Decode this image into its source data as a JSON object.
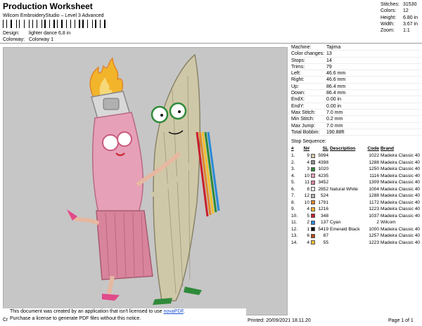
{
  "header": {
    "title": "Production Worksheet",
    "subtitle": "Wilcom EmbroideryStudio – Level 3 Advanced"
  },
  "meta": {
    "design_label": "Design:",
    "design_value": "lighter dance 6,8 in",
    "colorway_label": "Colorway:",
    "colorway_value": "Colorway 1"
  },
  "stats": [
    {
      "k": "Stitches:",
      "v": "31530"
    },
    {
      "k": "Colors:",
      "v": "12"
    },
    {
      "k": "Height:",
      "v": "6.80 in"
    },
    {
      "k": "Width:",
      "v": "3.67 in"
    },
    {
      "k": "Zoom:",
      "v": "1:1"
    }
  ],
  "machine": [
    {
      "k": "Machine:",
      "v": "Tajima"
    },
    {
      "k": "Color changes:",
      "v": "13"
    },
    {
      "k": "Stops:",
      "v": "14"
    },
    {
      "k": "Trims:",
      "v": "79"
    },
    {
      "k": "Left:",
      "v": "46.6 mm"
    },
    {
      "k": "Right:",
      "v": "46.6 mm"
    },
    {
      "k": "Up:",
      "v": "86.4 mm"
    },
    {
      "k": "Down:",
      "v": "86.4 mm"
    },
    {
      "k": "EndX:",
      "v": "0.00 in"
    },
    {
      "k": "EndY:",
      "v": "0.00 in"
    },
    {
      "k": "Max Stitch:",
      "v": "7.0 mm"
    },
    {
      "k": "Min Stitch:",
      "v": "0.2 mm"
    },
    {
      "k": "Max Jump:",
      "v": "7.0 mm"
    },
    {
      "k": "Total Bobbin:",
      "v": "190.88ft"
    }
  ],
  "stop_sequence": {
    "label": "Stop Sequence:",
    "headers": [
      "#",
      "N#",
      "SL",
      "Description",
      "Code",
      "Brand"
    ],
    "rows": [
      {
        "num": "1.",
        "n": "9",
        "color": "#cfc8a8",
        "sl": "5994",
        "desc": "",
        "code": "1022",
        "brand": "Madeira Classic 40"
      },
      {
        "num": "2.",
        "n": "4",
        "color": "#8a8a8a",
        "sl": "4398",
        "desc": "",
        "code": "1288",
        "brand": "Madeira Classic 40"
      },
      {
        "num": "3.",
        "n": "3",
        "color": "#2f8a3a",
        "sl": "1020",
        "desc": "",
        "code": "1250",
        "brand": "Madeira Classic 40"
      },
      {
        "num": "4.",
        "n": "10",
        "color": "#e6a0b8",
        "sl": "4235",
        "desc": "",
        "code": "1116",
        "brand": "Madeira Classic 40"
      },
      {
        "num": "5.",
        "n": "11",
        "color": "#d8849c",
        "sl": "3452",
        "desc": "",
        "code": "1309",
        "brand": "Madeira Classic 40"
      },
      {
        "num": "6.",
        "n": "8",
        "color": "#f2f0e6",
        "sl": "2852",
        "desc": "Natural White",
        "code": "1004",
        "brand": "Madeira Classic 40"
      },
      {
        "num": "7.",
        "n": "12",
        "color": "#b0b0b0",
        "sl": "524",
        "desc": "",
        "code": "1288",
        "brand": "Madeira Classic 40"
      },
      {
        "num": "8.",
        "n": "10",
        "color": "#e0862a",
        "sl": "1791",
        "desc": "",
        "code": "1172",
        "brand": "Madeira Classic 40"
      },
      {
        "num": "9.",
        "n": "4",
        "color": "#f2b42a",
        "sl": "1216",
        "desc": "",
        "code": "1223",
        "brand": "Madeira Classic 40"
      },
      {
        "num": "10.",
        "n": "5",
        "color": "#c81e2a",
        "sl": "348",
        "desc": "",
        "code": "1037",
        "brand": "Madeira Classic 40"
      },
      {
        "num": "11.",
        "n": "2",
        "color": "#2a8ad8",
        "sl": "137",
        "desc": "Cyan",
        "code": "2",
        "brand": "Wilcom"
      },
      {
        "num": "12.",
        "n": "1",
        "color": "#111111",
        "sl": "5419",
        "desc": "Emerald Black",
        "code": "1000",
        "brand": "Madeira Classic 40"
      },
      {
        "num": "13.",
        "n": "6",
        "color": "#b84a1a",
        "sl": "87",
        "desc": "",
        "code": "1257",
        "brand": "Madeira Classic 40"
      },
      {
        "num": "14.",
        "n": "4",
        "color": "#f2c02a",
        "sl": "55",
        "desc": "",
        "code": "1223",
        "brand": "Madeira Classic 40"
      }
    ]
  },
  "notice": {
    "line1_a": "This document was created by an application that isn't licensed to use ",
    "line1_link": "novaPDF",
    "line1_b": ".",
    "line2": "Purchase a license to generate PDF files without this notice."
  },
  "footer": {
    "cr": "Cr",
    "printed": "Printed: 20/09/2021 18.11.20",
    "page": "Page 1 of 1"
  }
}
